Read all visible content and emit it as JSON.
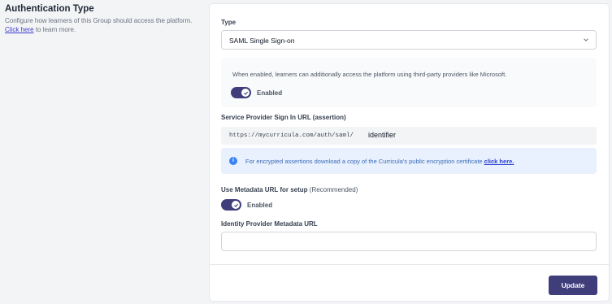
{
  "section": {
    "title": "Authentication Type",
    "desc_before": "Configure how learners of this Group should access the platform.",
    "link": "Click here",
    "desc_after": "to learn more."
  },
  "type_field": {
    "label": "Type",
    "value": "SAML Single Sign-on",
    "chevron_icon": "chevron-down-icon"
  },
  "third_party": {
    "description": "When enabled, learners can additionally access the platform using third-party providers like Microsoft.",
    "toggle_state": "on",
    "toggle_label": "Enabled"
  },
  "sp_url": {
    "label": "Service Provider Sign In URL (assertion)",
    "prefix": "https://mycurricula.com/auth/saml/",
    "identifier": "identifier"
  },
  "info": {
    "icon": "info-icon",
    "text": "For encrypted assertions download a copy of the Curricula's public encryption certificate",
    "link": "click here."
  },
  "metadata": {
    "label": "Use Metadata URL for setup",
    "label_note": "(Recommended)",
    "toggle_state": "on",
    "toggle_label": "Enabled"
  },
  "idp_url": {
    "label": "Identity Provider Metadata URL",
    "value": ""
  },
  "actions": {
    "update_label": "Update"
  },
  "colors": {
    "accent": "#3f3d7a",
    "info_bg": "#e8f1fd",
    "info_icon": "#3b82f6",
    "link": "#3b3bd1"
  }
}
